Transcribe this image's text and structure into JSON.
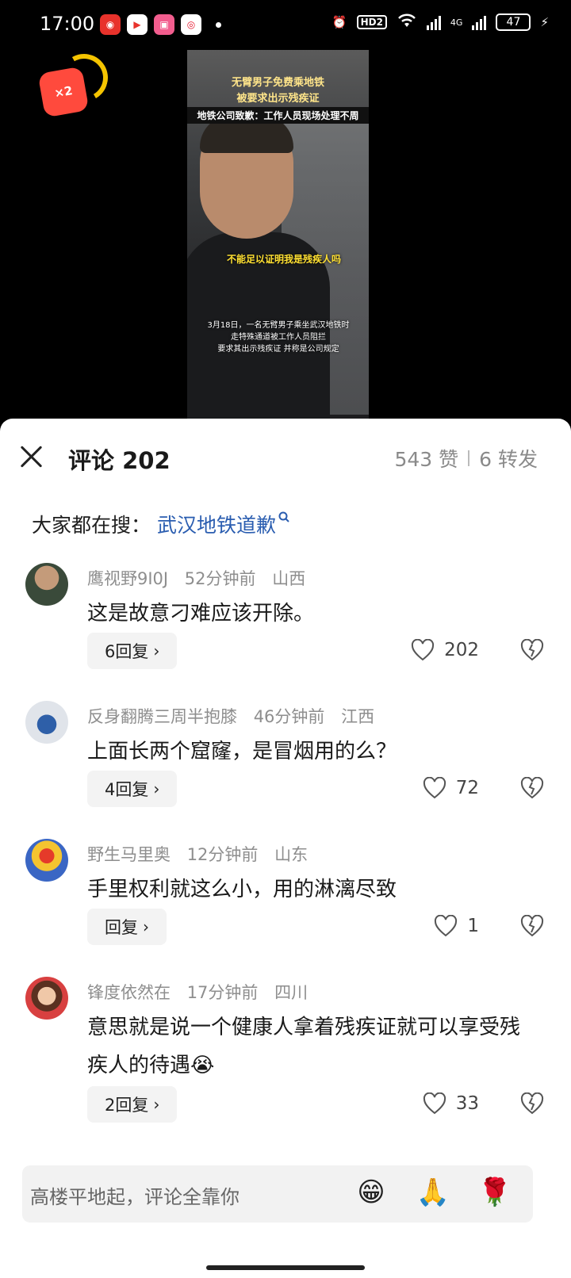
{
  "status_bar": {
    "time": "17:00",
    "app_icons": [
      "app-icon-red",
      "app-icon-video",
      "app-icon-bilibili",
      "app-icon-weibo"
    ],
    "hd_label": "HD2",
    "network_label": "4G",
    "battery": "47"
  },
  "red_packet": {
    "label": "×2"
  },
  "video": {
    "title_line1": "无臂男子免费乘地铁",
    "title_line2": "被要求出示残疾证",
    "title_line3": "地铁公司致歉：工作人员现场处理不周",
    "quote": "不能足以证明我是残疾人吗",
    "caption_lines": [
      "3月18日，一名无臂男子乘坐武汉地铁时",
      "走特殊通道被工作人员阻拦",
      "要求其出示残疾证 并称是公司规定"
    ]
  },
  "panel": {
    "title": "评论 202",
    "likes": "543 赞",
    "shares": "6 转发",
    "search_prefix": "大家都在搜：",
    "search_term": "武汉地铁道歉"
  },
  "comments": [
    {
      "user": "鹰视野9I0J",
      "time": "52分钟前",
      "location": "山西",
      "text": "这是故意刁难应该开除。",
      "replies": "6回复",
      "likes": "202"
    },
    {
      "user": "反身翻腾三周半抱膝",
      "time": "46分钟前",
      "location": "江西",
      "text": "上面长两个窟窿，是冒烟用的么？",
      "replies": "4回复",
      "likes": "72"
    },
    {
      "user": "野生马里奥",
      "time": "12分钟前",
      "location": "山东",
      "text": "手里权利就这么小，用的淋漓尽致",
      "replies": "回复",
      "likes": "1"
    },
    {
      "user": "锋度依然在",
      "time": "17分钟前",
      "location": "四川",
      "text": "意思就是说一个健康人拿着残疾证就可以享受残疾人的待遇😭",
      "replies": "2回复",
      "likes": "33"
    }
  ],
  "input": {
    "placeholder": "高楼平地起，评论全靠你",
    "emojis": [
      "😁",
      "🙏",
      "🌹"
    ]
  },
  "colors": {
    "link": "#2a5db0",
    "panel_bg": "#ffffff",
    "meta": "#8e8e8e"
  }
}
